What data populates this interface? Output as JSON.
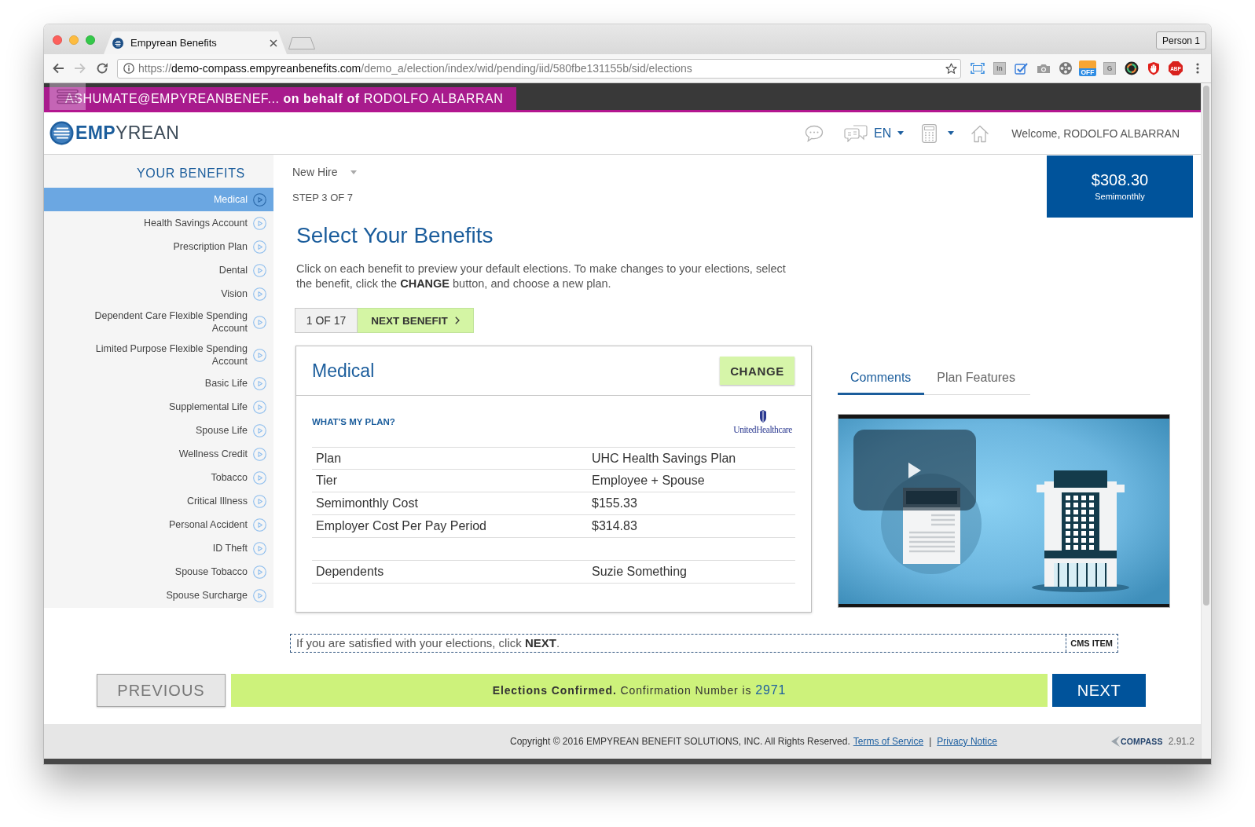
{
  "browser": {
    "tab": {
      "title": "Empyrean Benefits"
    },
    "address": {
      "scheme": "https://",
      "host": "demo-compass.empyreanbenefits.com",
      "path": "/demo_a/election/index/wid/pending/iid/580fbe131155b/sid/elections"
    },
    "extensions": [
      {
        "kind": "frame"
      },
      {
        "kind": "tile",
        "label": "In"
      },
      {
        "kind": "check"
      },
      {
        "kind": "camera"
      },
      {
        "kind": "reel"
      },
      {
        "kind": "badge",
        "label": "OFF"
      },
      {
        "kind": "tile",
        "label": "G"
      },
      {
        "kind": "ring"
      },
      {
        "kind": "hand"
      },
      {
        "kind": "stop",
        "label": "ABP"
      }
    ],
    "profile": "Person 1"
  },
  "banner": {
    "text": "ASHUMATE@EMPYREANBENEF... **on behalf of** RODOLFO ALBARRAN"
  },
  "header": {
    "logo": "**EMP**YREAN",
    "language": "EN",
    "welcome": "Welcome, RODOLFO ALBARRAN"
  },
  "sidebar": {
    "title": "YOUR BENEFITS",
    "items": [
      {
        "label": "Medical",
        "selected": true
      },
      {
        "label": "Health Savings Account",
        "selected": false
      },
      {
        "label": "Prescription Plan",
        "selected": false
      },
      {
        "label": "Dental",
        "selected": false
      },
      {
        "label": "Vision",
        "selected": false
      },
      {
        "label": "Dependent Care Flexible Spending Account",
        "selected": false
      },
      {
        "label": "Limited Purpose Flexible Spending Account",
        "selected": false
      },
      {
        "label": "Basic Life",
        "selected": false
      },
      {
        "label": "Supplemental Life",
        "selected": false
      },
      {
        "label": "Spouse Life",
        "selected": false
      },
      {
        "label": "Wellness Credit",
        "selected": false
      },
      {
        "label": "Tobacco",
        "selected": false
      },
      {
        "label": "Critical Illness",
        "selected": false
      },
      {
        "label": "Personal Accident",
        "selected": false
      },
      {
        "label": "ID Theft",
        "selected": false
      },
      {
        "label": "Spouse Tobacco",
        "selected": false
      },
      {
        "label": "Spouse Surcharge",
        "selected": false
      }
    ]
  },
  "main": {
    "event": "New Hire",
    "step": "STEP 3 OF 7",
    "title": "Select Your Benefits",
    "intro": "Click on each benefit to preview your default elections. To make changes to your elections, select the benefit, click the **CHANGE** button, and choose a new plan.",
    "counter": "1 OF 17",
    "next_benefit": "NEXT BENEFIT"
  },
  "card": {
    "title": "Medical",
    "action": "CHANGE",
    "link": "WHAT'S MY PLAN?",
    "carrier": "UnitedHealthcare",
    "rows": [
      {
        "label": "Plan",
        "value": "UHC Health Savings Plan"
      },
      {
        "label": "Tier",
        "value": "Employee + Spouse"
      },
      {
        "label": "Semimonthly Cost",
        "value": "$155.33"
      },
      {
        "label": "Employer Cost Per Pay Period",
        "value": "$314.83"
      }
    ],
    "dependents": [
      {
        "label": "Dependents",
        "value": "Suzie Something"
      }
    ]
  },
  "summary": {
    "amount": "$308.30",
    "period": "Semimonthly"
  },
  "tabs": [
    {
      "label": "Comments",
      "selected": true
    },
    {
      "label": "Plan Features",
      "selected": false
    }
  ],
  "note": {
    "text": "If you are satisfied with your elections, click **NEXT**.",
    "tag": "CMS ITEM"
  },
  "actions": {
    "previous": "PREVIOUS",
    "status": "Elections Confirmed.",
    "message": "Confirmation Number is",
    "number": "2971",
    "next": "NEXT"
  },
  "footer": {
    "copyright": "Copyright © 2016 EMPYREAN BENEFIT SOLUTIONS, INC. All Rights Reserved.",
    "links": [
      "Terms of Service",
      "Privacy Notice"
    ],
    "separator": "|",
    "brand": "COMPASS",
    "version": "2.91.2"
  }
}
